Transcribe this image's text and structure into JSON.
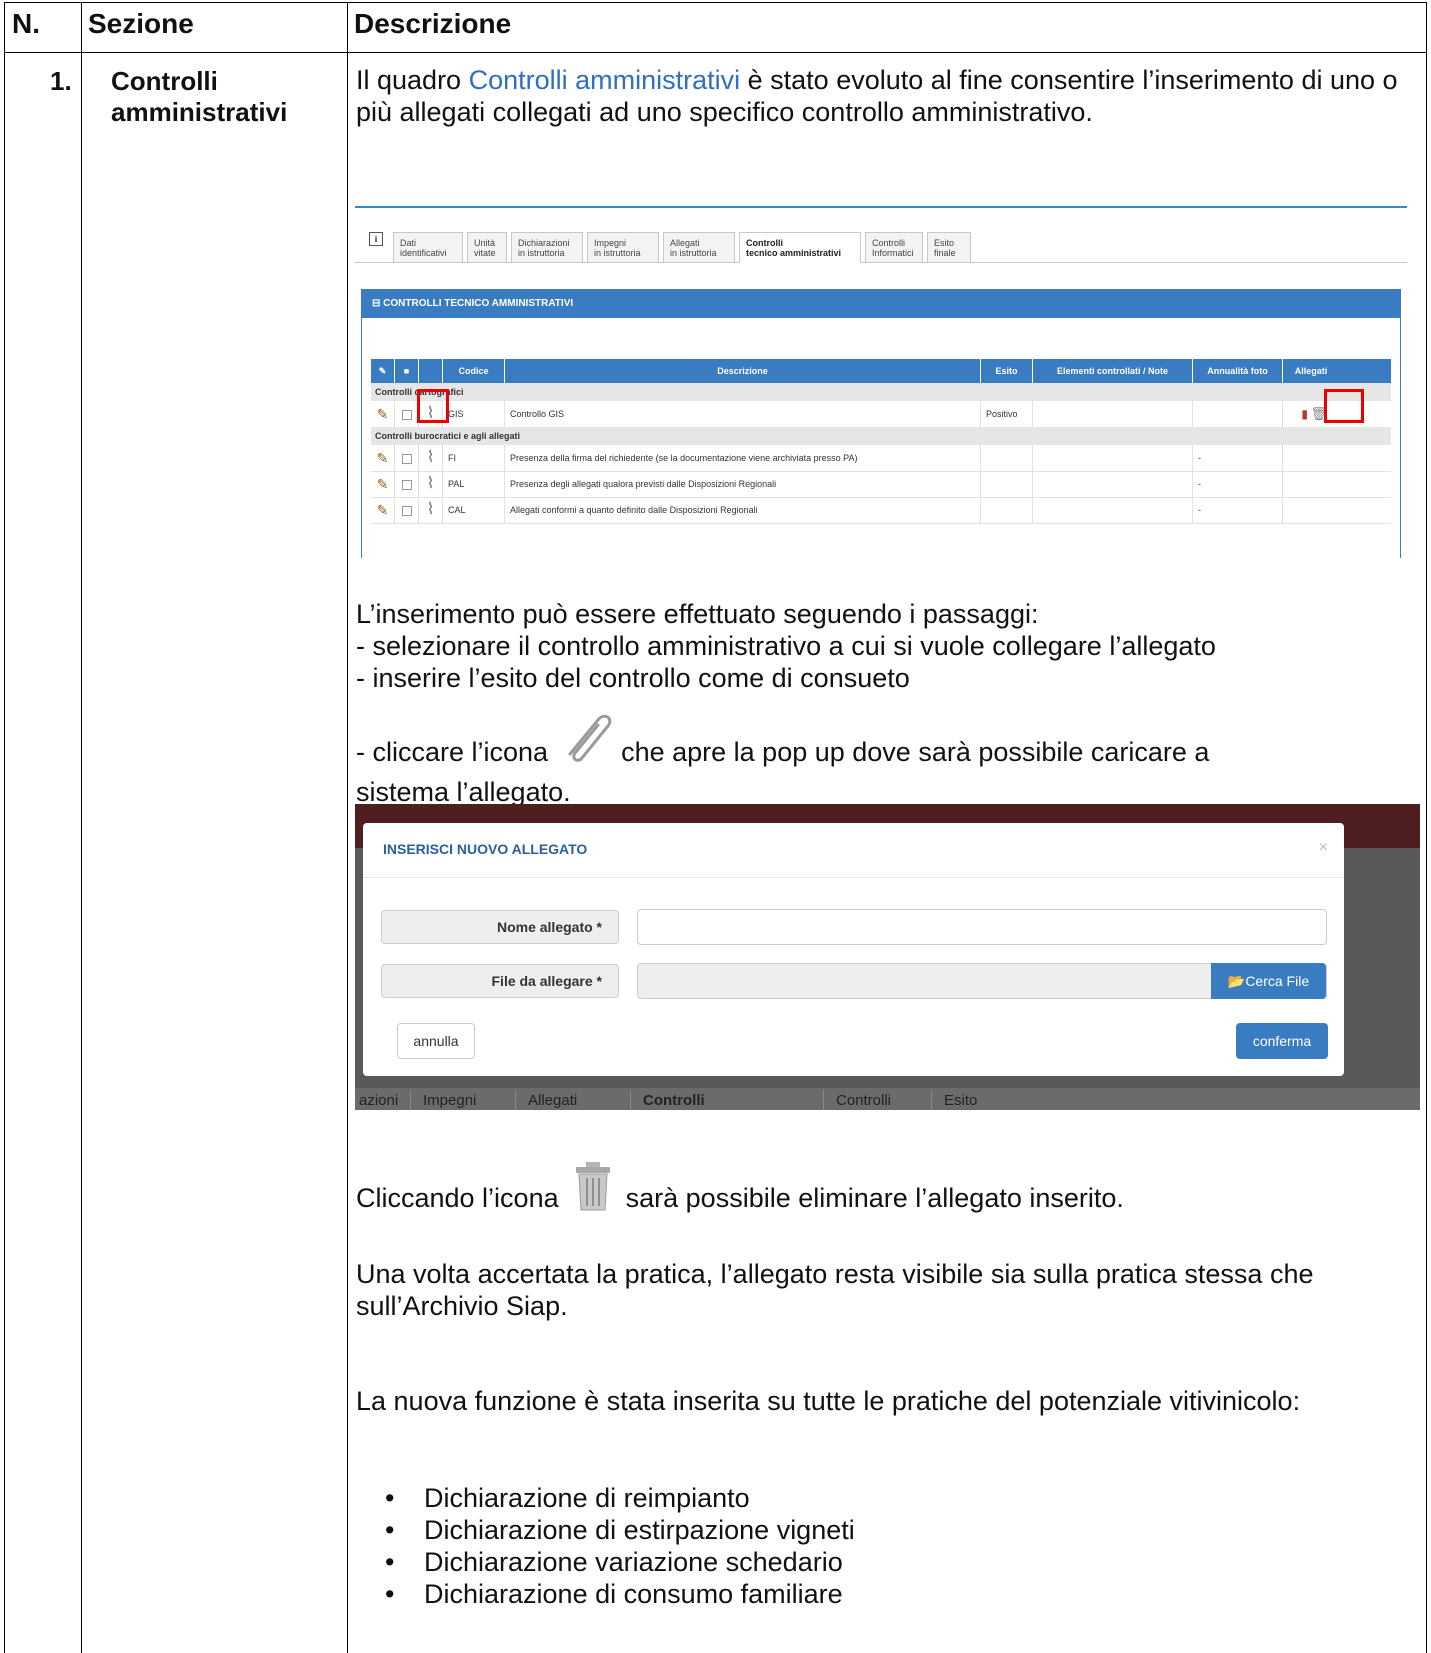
{
  "header": {
    "col_n": "N.",
    "col_sezione": "Sezione",
    "col_descrizione": "Descrizione"
  },
  "row": {
    "number": "1.",
    "section": "Controlli amministrativi"
  },
  "intro": {
    "prefix": "Il quadro ",
    "link": "Controlli amministrativi",
    "suffix": " è stato evoluto al fine consentire l’inserimento di uno o più allegati collegati ad uno specifico controllo amministrativo."
  },
  "shot1": {
    "tabs": [
      {
        "l1": "Dati",
        "l2": "identificativi"
      },
      {
        "l1": "Unità",
        "l2": "vitate"
      },
      {
        "l1": "Dichiarazioni",
        "l2": "in istruttoria"
      },
      {
        "l1": "Impegni",
        "l2": "in istruttoria"
      },
      {
        "l1": "Allegati",
        "l2": "in istruttoria"
      },
      {
        "l1": "Controlli",
        "l2": "tecnico amministrativi"
      },
      {
        "l1": "Controlli",
        "l2": "Informatici"
      },
      {
        "l1": "Esito",
        "l2": "finale"
      }
    ],
    "panel_title": "⊟ CONTROLLI TECNICO AMMINISTRATIVI",
    "columns": {
      "codice": "Codice",
      "descrizione": "Descrizione",
      "esito": "Esito",
      "elementi": "Elementi controllati / Note",
      "annualita": "Annualità foto",
      "allegati": "Allegati"
    },
    "group1": "Controlli cartografici",
    "group2": "Controlli burocratici e agli allegati",
    "rows": [
      {
        "code": "GIS",
        "desc": "Controllo GIS",
        "esito": "Positivo",
        "anno": ""
      },
      {
        "code": "FI",
        "desc": "Presenza della firma del richiedente (se la documentazione viene archiviata presso PA)",
        "esito": "",
        "anno": "-"
      },
      {
        "code": "PAL",
        "desc": "Presenza degli allegati qualora previsti dalle Disposizioni Regionali",
        "esito": "",
        "anno": "-"
      },
      {
        "code": "CAL",
        "desc": "Allegati conformi a quanto definito dalle Disposizioni Regionali",
        "esito": "",
        "anno": "-"
      }
    ]
  },
  "steps": {
    "intro": "L’inserimento può essere effettuato seguendo i passaggi:",
    "s1": "- selezionare il controllo amministrativo a cui si vuole collegare l’allegato",
    "s2": "- inserire l’esito del controllo come di consueto",
    "s3_pre": "- cliccare l’icona",
    "s3_post": "che apre la pop up dove sarà possibile caricare a",
    "s3_cont": "sistema l’allegato."
  },
  "modal": {
    "title": "INSERISCI NUOVO ALLEGATO",
    "close": "×",
    "label_nome": "Nome allegato *",
    "label_file": "File da allegare *",
    "search_button": "Cerca File",
    "cancel_button": "annulla",
    "confirm_button": "conferma",
    "bg_tabs": [
      "azioni",
      "Impegni",
      "Allegati",
      "Controlli",
      "Controlli",
      "Esito"
    ]
  },
  "delete_note": {
    "pre": "Cliccando l’icona",
    "post": "sarà possibile eliminare l’allegato inserito."
  },
  "para_visible": "Una volta accertata la pratica, l’allegato resta visibile sia sulla pratica stessa che sull’Archivio Siap.",
  "para_function": "La nuova funzione è stata inserita su tutte le pratiche del potenziale vitivinicolo:",
  "bullets": [
    "Dichiarazione di reimpianto",
    "Dichiarazione di estirpazione vigneti",
    "Dichiarazione variazione schedario",
    "Dichiarazione di consumo familiare"
  ]
}
